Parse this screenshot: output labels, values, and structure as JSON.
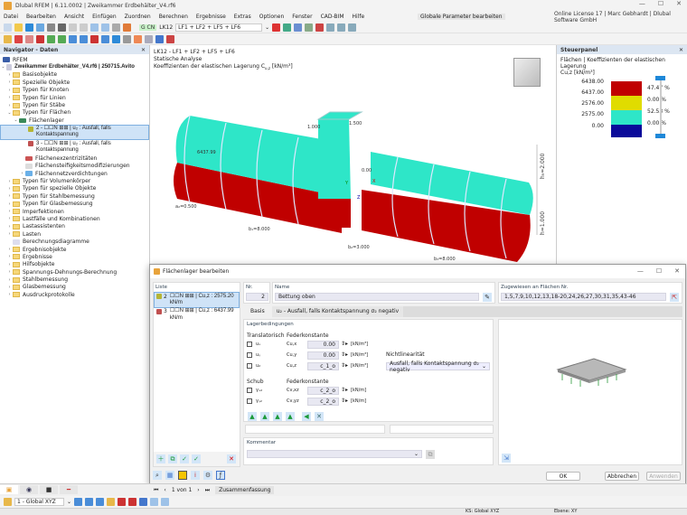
{
  "window": {
    "title": "Dlubal RFEM | 6.11.0002 | Zweikammer Erdbehälter_V4.rf6",
    "minimize": "—",
    "maximize": "☐",
    "close": "✕"
  },
  "menu": [
    "Datei",
    "Bearbeiten",
    "Ansicht",
    "Einfügen",
    "Zuordnen",
    "Berechnen",
    "Ergebnisse",
    "Extras",
    "Optionen",
    "Fenster",
    "CAD-BIM",
    "Hilfe"
  ],
  "license": "Online License 17 | Marc Gebhardt | Dlubal Software GmbH",
  "globale_parameter": "Globale Parameter bearbeiten",
  "toolbar": {
    "lc_badge": "G CN",
    "lc_code": "LK12",
    "lc_combo": "LF1 + LF2 + LF5 + LF6"
  },
  "navigator": {
    "title": "Navigator - Daten",
    "root": "RFEM",
    "file": "Zweikammer Erdbehälter_V4.rf6 | 250715.Avito",
    "items_top": [
      "Basisobjekte",
      "Spezielle Objekte",
      "Typen für Knoten",
      "Typen für Linien",
      "Typen für Stäbe",
      "Typen für Flächen"
    ],
    "flaechenlager": "Flächenlager",
    "lager_items": [
      "2 - ☐☐N  ⊞⊞ | u₂ : Ausfall, falls Kontaktspannung",
      "3 - ☐☐N  ⊞⊞ | u₂ : Ausfall, falls Kontaktspannung"
    ],
    "sub_items": [
      "Flächenexzentrizitäten",
      "Flächensteifigkeitsmodifizierungen",
      "Flächennetzverdichtungen"
    ],
    "items_bottom": [
      "Typen für Volumenkörper",
      "Typen für spezielle Objekte",
      "Typen für Stahlbemessung",
      "Typen für Glasbemessung",
      "Imperfektionen",
      "Lastfälle und Kombinationen",
      "Lastassistenten",
      "Lasten",
      "Berechnungsdiagramme",
      "Ergebnisobjekte",
      "Ergebnisse",
      "Hilfsobjekte",
      "Spannungs-Dehnungs-Berechnung",
      "Stahlbemessung",
      "Glasbemessung",
      "Ausdruckprotokolle"
    ]
  },
  "view": {
    "line1": "LK12 - LF1 + LF2 + LF5 + LF6",
    "line2": "Statische Analyse",
    "line3": "Koeffizienten der elastischen Lagerung C",
    "line3_sub": "u,z",
    "line3_unit": " [kN/m³]",
    "labels": {
      "value1": "6437.99",
      "value2": "0.00",
      "dim_a": "a₂=0.500",
      "dim_b1": "b₁=8.000",
      "dim_b2": "b₂=3.000",
      "dim_b3": "b₃=8.000",
      "dim_h": "h=1.000",
      "dim_hg": "h₉=2.000",
      "dim_t": "1.000",
      "dim_w": "1.500",
      "axis_x": "X",
      "axis_y": "Y",
      "axis_z": "Z"
    },
    "colors": {
      "upper": "#2ee6c8",
      "lower": "#c00000"
    }
  },
  "steuerpanel": {
    "title": "Steuerpanel",
    "subtitle": "Flächen | Koeffizienten der elastischen Lagerung",
    "subtitle2": "Cu,z [kN/m³]",
    "legend": [
      {
        "value": "6438.00",
        "color": "#c00000",
        "percent": "47.47 %"
      },
      {
        "value": "6437.00",
        "color": "#e0dc00",
        "percent": "0.00 %"
      },
      {
        "value": "2576.00",
        "color": "#2ee6c8",
        "percent": "52.53 %"
      },
      {
        "value": "2575.00",
        "color": "#0a0a9a",
        "percent": "0.00 %"
      },
      {
        "value": "0.00"
      }
    ]
  },
  "dialog": {
    "title": "Flächenlager bearbeiten",
    "liste_label": "Liste",
    "list": [
      {
        "no": "2",
        "text": "☐☐N ⊞⊞ | Cu,z : 2575.20 kN/m",
        "color": "#b5b535"
      },
      {
        "no": "3",
        "text": "☐☐N ⊞⊞ | Cu,z : 6437.99 kN/m",
        "color": "#c05050"
      }
    ],
    "nr_label": "Nr.",
    "nr": "2",
    "name_label": "Name",
    "name": "Bettung oben",
    "assigned_label": "Zugewiesen an Flächen Nr.",
    "assigned": "1,5,7,9,10,12,13,18-20,24,26,27,30,31,35,43-46",
    "tabs": [
      "Basis",
      "u₂ - Ausfall, falls Kontaktspannung σ₂ negativ"
    ],
    "lagerbedingungen": "Lagerbedingungen",
    "translatorisch": "Translatorisch",
    "federkonstante": "Federkonstante",
    "trans_rows": [
      {
        "dof": "uₓ",
        "c": "Cu,x",
        "val": "0.00",
        "unit": "[kN/m³]"
      },
      {
        "dof": "uᵧ",
        "c": "Cu,y",
        "val": "0.00",
        "unit": "[kN/m³]"
      },
      {
        "dof": "u₂",
        "c": "Cu,z",
        "val": "c_1_o",
        "unit": "[kN/m³]"
      }
    ],
    "schub": "Schub",
    "schub_rows": [
      {
        "dof": "γₓ₂",
        "c": "Cv,xz",
        "val": "c_2_o",
        "unit": "[kN/m]"
      },
      {
        "dof": "γᵧ₂",
        "c": "Cv,yz",
        "val": "c_2_o",
        "unit": "[kN/m]"
      }
    ],
    "nichtlinearitaet": "Nichtlinearität",
    "nl_value": "Ausfall, falls Kontaktspannung σ₂ negativ",
    "kommentar": "Kommentar",
    "ok": "OK",
    "abbrechen": "Abbrechen",
    "anwenden": "Anwenden"
  },
  "bottom": {
    "pager": "1 von 1",
    "tab": "Zusammenfassung",
    "cs": "1 - Global XYZ",
    "status_ks": "KS: Global XYZ",
    "status_ebene": "Ebene: XY"
  }
}
